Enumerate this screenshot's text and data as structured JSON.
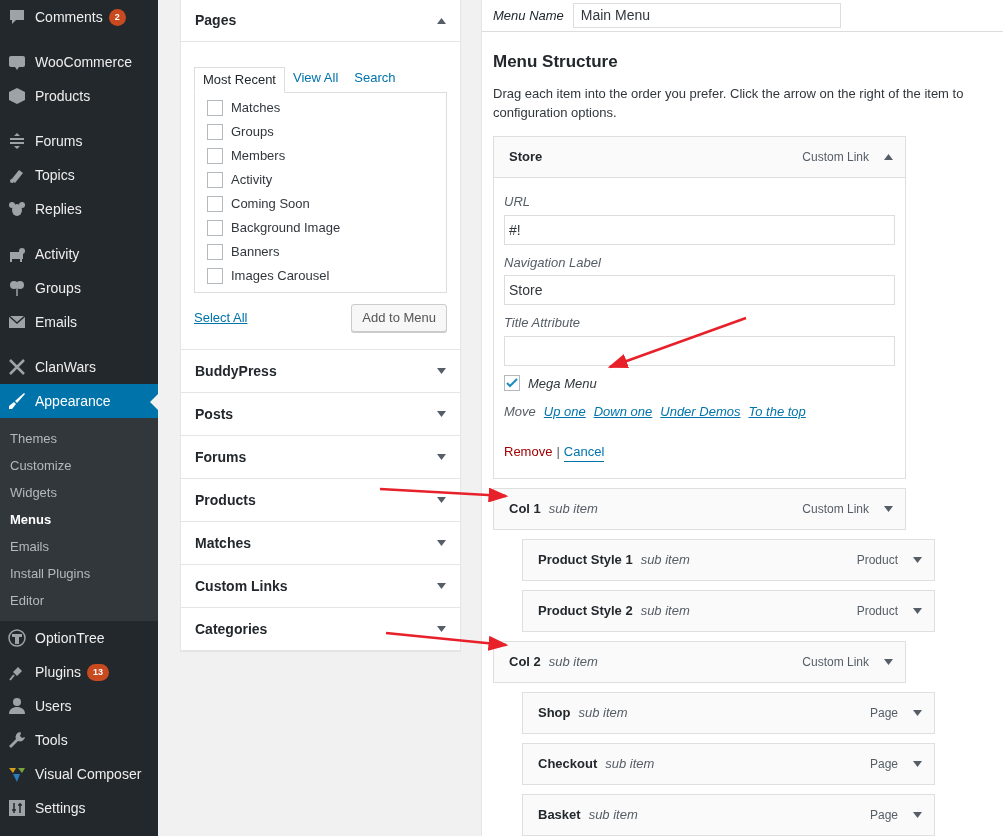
{
  "sidebar": {
    "groups": [
      [
        {
          "label": "Comments",
          "badge": "2",
          "current": false
        }
      ],
      [
        {
          "label": "WooCommerce",
          "current": false
        },
        {
          "label": "Products",
          "current": false
        }
      ],
      [
        {
          "label": "Forums",
          "current": false
        },
        {
          "label": "Topics",
          "current": false
        },
        {
          "label": "Replies",
          "current": false
        }
      ],
      [
        {
          "label": "Activity",
          "current": false
        },
        {
          "label": "Groups",
          "current": false
        },
        {
          "label": "Emails",
          "current": false
        }
      ],
      [
        {
          "label": "ClanWars",
          "current": false
        },
        {
          "label": "Appearance",
          "current": true,
          "submenu": [
            {
              "label": "Themes",
              "selected": false
            },
            {
              "label": "Customize",
              "selected": false
            },
            {
              "label": "Widgets",
              "selected": false
            },
            {
              "label": "Menus",
              "selected": true
            },
            {
              "label": "Emails",
              "selected": false
            },
            {
              "label": "Install Plugins",
              "selected": false
            },
            {
              "label": "Editor",
              "selected": false
            }
          ]
        },
        {
          "label": "OptionTree",
          "current": false
        },
        {
          "label": "Plugins",
          "badge": "13",
          "current": false
        },
        {
          "label": "Users",
          "current": false
        },
        {
          "label": "Tools",
          "current": false
        },
        {
          "label": "Visual Composer",
          "current": false
        },
        {
          "label": "Settings",
          "current": false
        }
      ]
    ]
  },
  "add_items": {
    "panels": [
      {
        "title": "Pages",
        "expanded": true,
        "tabs": [
          {
            "label": "Most Recent",
            "selected": true
          },
          {
            "label": "View All",
            "selected": false
          },
          {
            "label": "Search",
            "selected": false
          }
        ],
        "pages": [
          {
            "label": "Matches",
            "checked": false
          },
          {
            "label": "Groups",
            "checked": false
          },
          {
            "label": "Members",
            "checked": false
          },
          {
            "label": "Activity",
            "checked": false
          },
          {
            "label": "Coming Soon",
            "checked": false
          },
          {
            "label": "Background Image",
            "checked": false
          },
          {
            "label": "Banners",
            "checked": false
          },
          {
            "label": "Images Carousel",
            "checked": false
          }
        ],
        "select_all": "Select All",
        "add_button": "Add to Menu"
      },
      {
        "title": "BuddyPress",
        "expanded": false
      },
      {
        "title": "Posts",
        "expanded": false
      },
      {
        "title": "Forums",
        "expanded": false
      },
      {
        "title": "Products",
        "expanded": false
      },
      {
        "title": "Matches",
        "expanded": false
      },
      {
        "title": "Custom Links",
        "expanded": false
      },
      {
        "title": "Categories",
        "expanded": false
      }
    ]
  },
  "menu": {
    "name_label": "Menu Name",
    "name_value": "Main Menu",
    "heading": "Menu Structure",
    "description": "Drag each item into the order you prefer. Click the arrow on the right of the item to configuration options.",
    "items": [
      {
        "title": "Store",
        "type": "Custom Link",
        "expanded": true,
        "settings": {
          "url_label": "URL",
          "url": "#!",
          "nav_label": "Navigation Label",
          "nav_value": "Store",
          "title_label": "Title Attribute",
          "mega_menu": {
            "label": "Mega Menu",
            "checked": true
          },
          "move_label": "Move",
          "move_links": [
            "Up one",
            "Down one",
            "Under Demos",
            "To the top"
          ],
          "remove": "Remove",
          "separator": "|",
          "cancel": "Cancel"
        }
      },
      {
        "title": "Col 1",
        "note": "sub item",
        "type": "Custom Link",
        "expanded": false,
        "children": [
          {
            "title": "Product Style 1",
            "note": "sub item",
            "type": "Product",
            "expanded": false
          },
          {
            "title": "Product Style 2",
            "note": "sub item",
            "type": "Product",
            "expanded": false
          }
        ]
      },
      {
        "title": "Col 2",
        "note": "sub item",
        "type": "Custom Link",
        "expanded": false,
        "children": [
          {
            "title": "Shop",
            "note": "sub item",
            "type": "Page",
            "expanded": false
          },
          {
            "title": "Checkout",
            "note": "sub item",
            "type": "Page",
            "expanded": false
          },
          {
            "title": "Basket",
            "note": "sub item",
            "type": "Page",
            "expanded": false
          }
        ]
      }
    ]
  }
}
